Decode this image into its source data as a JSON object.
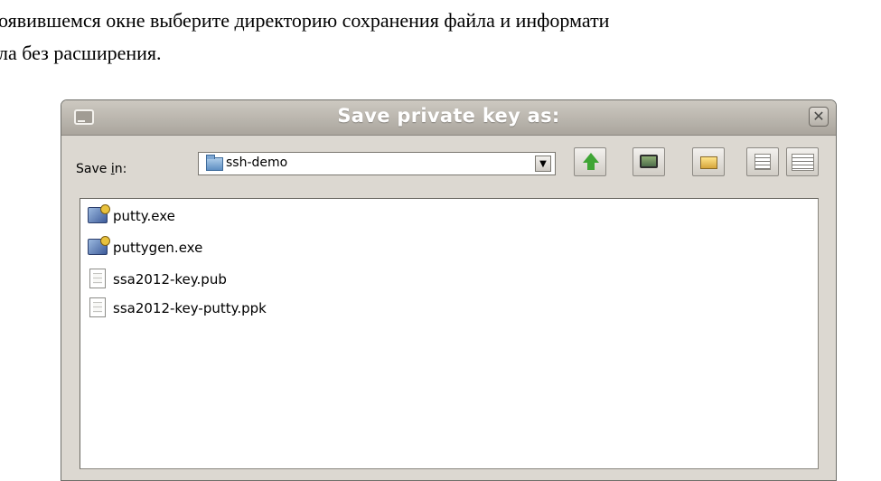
{
  "document": {
    "line1": "оявившемся окне выберите директорию сохранения файла и информати",
    "line2": "ла без расширения."
  },
  "dialog": {
    "title": "Save private key as:",
    "close_glyph": "✕",
    "save_in_label_pre": "Save ",
    "save_in_label_mnemonic": "i",
    "save_in_label_post": "n:",
    "current_directory": "ssh-demo",
    "combo_arrow_glyph": "▼",
    "toolbar_icons": [
      "up-one-level-icon",
      "desktop-icon",
      "new-folder-icon",
      "list-view-icon",
      "details-view-icon"
    ],
    "files": [
      {
        "name": "putty.exe",
        "icon": "exe-icon"
      },
      {
        "name": "puttygen.exe",
        "icon": "exe-icon"
      },
      {
        "name": "ssa2012-key.pub",
        "icon": "document-icon"
      },
      {
        "name": "ssa2012-key-putty.ppk",
        "icon": "document-icon"
      }
    ]
  }
}
